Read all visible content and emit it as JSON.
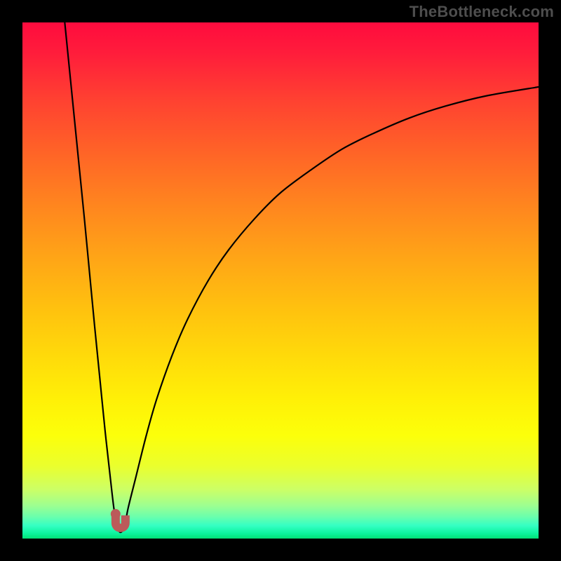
{
  "watermark": "TheBottleneck.com",
  "chart_data": {
    "type": "line",
    "title": "",
    "xlabel": "",
    "ylabel": "",
    "xlim": [
      0,
      100
    ],
    "ylim": [
      0,
      100
    ],
    "curve_note": "Sharp V-shaped dip near x≈18, y≈0 then asymptotic rise toward ~87 at right edge; left branch rises to y≈100 at x≈8.",
    "curve_points": [
      [
        8.2,
        100.0
      ],
      [
        9.0,
        92.0
      ],
      [
        10.0,
        82.0
      ],
      [
        11.0,
        72.0
      ],
      [
        12.0,
        62.0
      ],
      [
        13.0,
        51.5
      ],
      [
        14.0,
        41.0
      ],
      [
        15.0,
        31.0
      ],
      [
        16.0,
        21.0
      ],
      [
        17.0,
        12.0
      ],
      [
        17.7,
        6.0
      ],
      [
        18.3,
        2.5
      ],
      [
        19.0,
        1.2
      ],
      [
        19.8,
        2.5
      ],
      [
        20.5,
        6.0
      ],
      [
        22.0,
        12.0
      ],
      [
        24.0,
        20.0
      ],
      [
        26.0,
        27.0
      ],
      [
        29.0,
        35.5
      ],
      [
        32.0,
        42.5
      ],
      [
        36.0,
        50.0
      ],
      [
        40.0,
        56.0
      ],
      [
        45.0,
        62.0
      ],
      [
        50.0,
        67.0
      ],
      [
        56.0,
        71.5
      ],
      [
        62.0,
        75.5
      ],
      [
        68.0,
        78.5
      ],
      [
        75.0,
        81.5
      ],
      [
        82.0,
        83.8
      ],
      [
        90.0,
        85.8
      ],
      [
        100.0,
        87.5
      ]
    ],
    "marker": {
      "x": 19.0,
      "y": 3.0,
      "color": "#bb5a5a"
    },
    "gradient_stops": [
      {
        "offset": 0.0,
        "color": "#ff0b3e"
      },
      {
        "offset": 0.06,
        "color": "#ff1d3b"
      },
      {
        "offset": 0.15,
        "color": "#ff4131"
      },
      {
        "offset": 0.25,
        "color": "#ff6327"
      },
      {
        "offset": 0.35,
        "color": "#ff841f"
      },
      {
        "offset": 0.45,
        "color": "#ffa317"
      },
      {
        "offset": 0.55,
        "color": "#ffc00f"
      },
      {
        "offset": 0.65,
        "color": "#ffdb0a"
      },
      {
        "offset": 0.73,
        "color": "#fff007"
      },
      {
        "offset": 0.8,
        "color": "#fcff0a"
      },
      {
        "offset": 0.86,
        "color": "#eaff2e"
      },
      {
        "offset": 0.905,
        "color": "#ccff66"
      },
      {
        "offset": 0.935,
        "color": "#9fff8f"
      },
      {
        "offset": 0.958,
        "color": "#6affad"
      },
      {
        "offset": 0.975,
        "color": "#34ffc3"
      },
      {
        "offset": 0.99,
        "color": "#0cf59e"
      },
      {
        "offset": 1.0,
        "color": "#02e176"
      }
    ]
  }
}
